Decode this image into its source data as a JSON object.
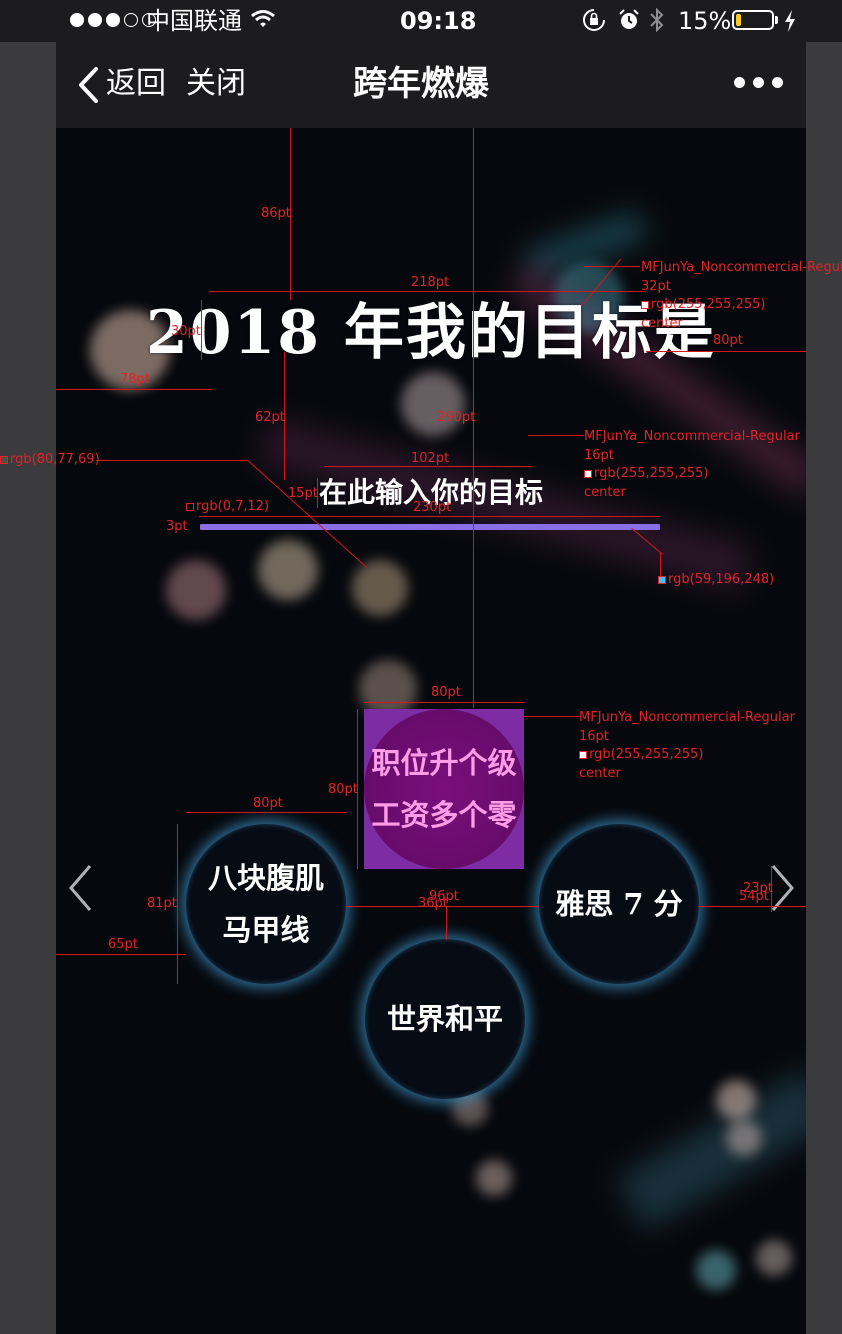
{
  "status_bar": {
    "carrier": "中国联通",
    "time": "09:18",
    "battery_percent": "15%",
    "battery_level": 0.15,
    "icons": [
      "signal-dots",
      "wifi-icon",
      "orientation-lock-icon",
      "alarm-icon",
      "bluetooth-icon",
      "battery-icon",
      "charging-icon"
    ]
  },
  "nav": {
    "back_label": "返回",
    "close_label": "关闭",
    "title": "跨年燃爆",
    "more_icon": "more-icon"
  },
  "main": {
    "title": "2018 年我的目标是",
    "input_prompt": "在此输入你的目标",
    "goals": [
      {
        "label_line1": "职位升个级",
        "label_line2": "工资多个零",
        "selected": true
      },
      {
        "label_line1": "八块腹肌",
        "label_line2": "马甲线",
        "selected": false
      },
      {
        "label_line1": "雅思 7 分",
        "label_line2": "",
        "selected": false
      },
      {
        "label_line1": "世界和平",
        "label_line2": "",
        "selected": false
      }
    ],
    "prev_icon": "chevron-left-icon",
    "next_icon": "chevron-right-icon"
  },
  "colors": {
    "title_text": "#ffffff",
    "input_line": "#8a6ee6",
    "selected_goal": "#7d2ca3",
    "goal_glow": "#3bc4f8",
    "annotation": "#e12327"
  },
  "spec": {
    "dim_86": "86pt",
    "dim_218": "218pt",
    "dim_30": "30pt",
    "dim_78": "78pt",
    "dim_80_right": "80pt",
    "dim_62": "62pt",
    "dim_290": "290pt",
    "dim_102": "102pt",
    "dim_15": "15pt",
    "dim_230": "230pt",
    "dim_3": "3pt",
    "dim_80_top": "80pt",
    "dim_80_side": "80pt",
    "dim_80_left": "80pt",
    "dim_81": "81pt",
    "dim_65": "65pt",
    "dim_96": "96pt",
    "dim_36": "36pt",
    "dim_23": "23pt",
    "dim_54": "54pt",
    "font_a": "MFJunYa_Noncommercial-Regular",
    "size_a": "32pt",
    "color_a": "rgb(255,255,255)",
    "align_a": "center",
    "font_b": "MFJunYa_Noncommercial-Regular",
    "size_b": "16pt",
    "color_b": "rgb(255,255,255)",
    "align_b": "center",
    "font_c": "MFJunYa_Noncommercial-Regular",
    "size_c": "16pt",
    "color_c": "rgb(255,255,255)",
    "align_c": "center",
    "bg_color": "rgb(80,77,69)",
    "dark_color": "rgb(0,7,12)",
    "line_color": "rgb(59,196,248)"
  }
}
